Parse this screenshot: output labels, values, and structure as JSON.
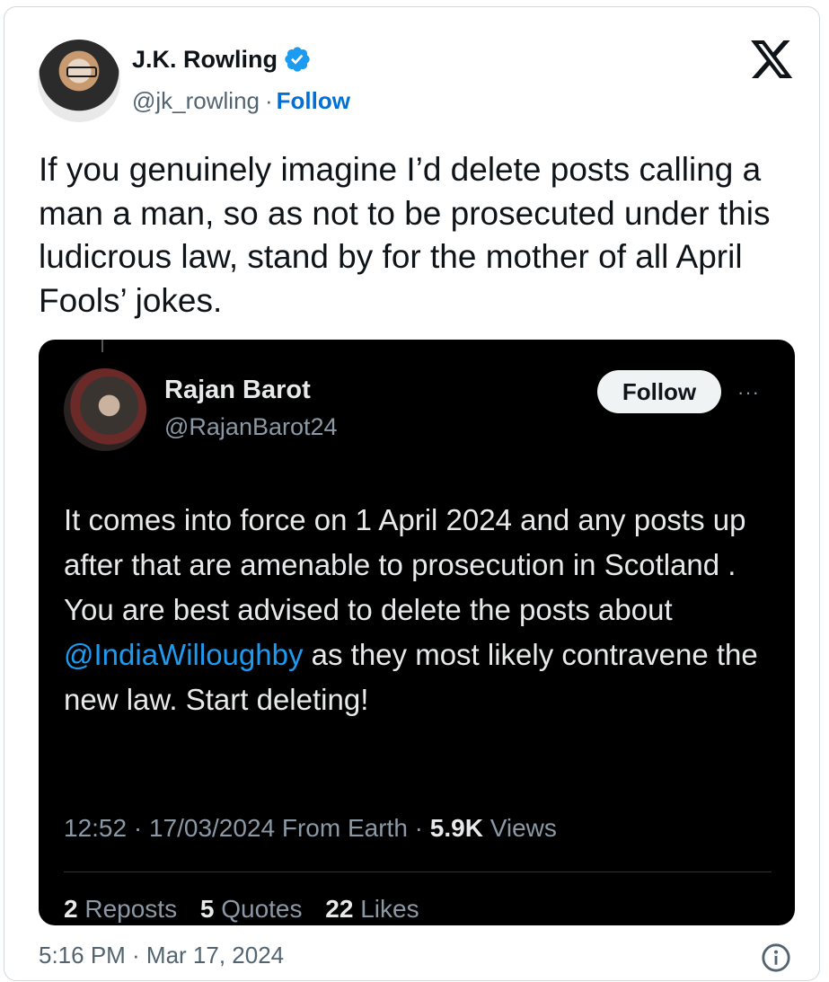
{
  "author": {
    "name": "J.K. Rowling",
    "handle": "@jk_rowling",
    "separator": "·",
    "follow_label": "Follow"
  },
  "tweet": {
    "text": "If you genuinely imagine I’d delete posts calling a man a man, so as not to be prosecuted under this ludicrous law, stand by for the mother of all April Fools’ jokes."
  },
  "quoted": {
    "name": "Rajan Barot",
    "handle": "@RajanBarot24",
    "follow_label": "Follow",
    "more_label": "···",
    "text_before": "It comes into force on 1 April 2024 and any posts up after that are amenable to prosecution in Scotland . You are best advised to delete the posts about ",
    "mention": "@IndiaWilloughby",
    "text_after": " as they most likely contravene the new law. Start deleting!",
    "time": "12:52 · 17/03/2024 From Earth · ",
    "views_count": "5.9K",
    "views_label": " Views",
    "reposts_count": "2",
    "reposts_label": " Reposts",
    "quotes_count": "5",
    "quotes_label": " Quotes",
    "likes_count": "22",
    "likes_label": " Likes"
  },
  "footer": {
    "timestamp": "5:16 PM · Mar 17, 2024"
  },
  "colors": {
    "link_blue": "#006fd6",
    "verified_blue": "#1d9bf0",
    "quote_background": "#000000"
  },
  "icons": [
    "verified-badge-icon",
    "x-logo-icon",
    "more-icon",
    "info-icon"
  ]
}
